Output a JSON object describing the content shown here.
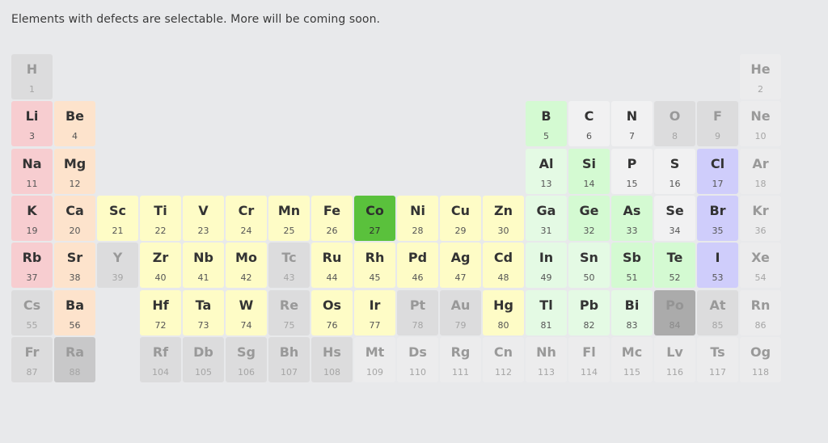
{
  "intro_text": "Elements with defects are selectable. More will be coming soon.",
  "palette": {
    "red": {
      "bg": "#f7cdd0",
      "fg": "#333333",
      "nfg": "#555555"
    },
    "peach": {
      "bg": "#fde3cc",
      "fg": "#333333",
      "nfg": "#555555"
    },
    "yellow": {
      "bg": "#fefcc6",
      "fg": "#333333",
      "nfg": "#555555"
    },
    "green": {
      "bg": "#d4fad2",
      "fg": "#333333",
      "nfg": "#555555"
    },
    "ltgreen": {
      "bg": "#e4fae4",
      "fg": "#333333",
      "nfg": "#555555"
    },
    "white": {
      "bg": "#f1f1f2",
      "fg": "#333333",
      "nfg": "#555555"
    },
    "blue": {
      "bg": "#cfcdfb",
      "fg": "#333333",
      "nfg": "#555555"
    },
    "selected": {
      "bg": "#5ac13c",
      "fg": "#2e2e2e",
      "nfg": "#2e2e2e"
    },
    "gray": {
      "bg": "#dcdcdd",
      "fg": "#999999",
      "nfg": "#a5a5a5"
    },
    "dkgray": {
      "bg": "#c8c8c9",
      "fg": "#9a9a9a",
      "nfg": "#a5a5a5"
    },
    "dkgray2": {
      "bg": "#ababab",
      "fg": "#949494",
      "nfg": "#8a8a8a"
    },
    "pale": {
      "bg": "#ececed",
      "fg": "#999999",
      "nfg": "#a5a5a5"
    }
  },
  "elements": [
    {
      "symbol": "H",
      "number": "1",
      "row": 1,
      "col": 1,
      "cat": "gray",
      "selectable": false
    },
    {
      "symbol": "He",
      "number": "2",
      "row": 1,
      "col": 18,
      "cat": "pale",
      "selectable": false
    },
    {
      "symbol": "Li",
      "number": "3",
      "row": 2,
      "col": 1,
      "cat": "red",
      "selectable": true
    },
    {
      "symbol": "Be",
      "number": "4",
      "row": 2,
      "col": 2,
      "cat": "peach",
      "selectable": true
    },
    {
      "symbol": "B",
      "number": "5",
      "row": 2,
      "col": 13,
      "cat": "green",
      "selectable": true
    },
    {
      "symbol": "C",
      "number": "6",
      "row": 2,
      "col": 14,
      "cat": "white",
      "selectable": true
    },
    {
      "symbol": "N",
      "number": "7",
      "row": 2,
      "col": 15,
      "cat": "white",
      "selectable": true
    },
    {
      "symbol": "O",
      "number": "8",
      "row": 2,
      "col": 16,
      "cat": "gray",
      "selectable": false
    },
    {
      "symbol": "F",
      "number": "9",
      "row": 2,
      "col": 17,
      "cat": "gray",
      "selectable": false
    },
    {
      "symbol": "Ne",
      "number": "10",
      "row": 2,
      "col": 18,
      "cat": "pale",
      "selectable": false
    },
    {
      "symbol": "Na",
      "number": "11",
      "row": 3,
      "col": 1,
      "cat": "red",
      "selectable": true
    },
    {
      "symbol": "Mg",
      "number": "12",
      "row": 3,
      "col": 2,
      "cat": "peach",
      "selectable": true
    },
    {
      "symbol": "Al",
      "number": "13",
      "row": 3,
      "col": 13,
      "cat": "ltgreen",
      "selectable": true
    },
    {
      "symbol": "Si",
      "number": "14",
      "row": 3,
      "col": 14,
      "cat": "green",
      "selectable": true
    },
    {
      "symbol": "P",
      "number": "15",
      "row": 3,
      "col": 15,
      "cat": "white",
      "selectable": true
    },
    {
      "symbol": "S",
      "number": "16",
      "row": 3,
      "col": 16,
      "cat": "white",
      "selectable": true
    },
    {
      "symbol": "Cl",
      "number": "17",
      "row": 3,
      "col": 17,
      "cat": "blue",
      "selectable": true
    },
    {
      "symbol": "Ar",
      "number": "18",
      "row": 3,
      "col": 18,
      "cat": "pale",
      "selectable": false
    },
    {
      "symbol": "K",
      "number": "19",
      "row": 4,
      "col": 1,
      "cat": "red",
      "selectable": true
    },
    {
      "symbol": "Ca",
      "number": "20",
      "row": 4,
      "col": 2,
      "cat": "peach",
      "selectable": true
    },
    {
      "symbol": "Sc",
      "number": "21",
      "row": 4,
      "col": 3,
      "cat": "yellow",
      "selectable": true
    },
    {
      "symbol": "Ti",
      "number": "22",
      "row": 4,
      "col": 4,
      "cat": "yellow",
      "selectable": true
    },
    {
      "symbol": "V",
      "number": "23",
      "row": 4,
      "col": 5,
      "cat": "yellow",
      "selectable": true
    },
    {
      "symbol": "Cr",
      "number": "24",
      "row": 4,
      "col": 6,
      "cat": "yellow",
      "selectable": true
    },
    {
      "symbol": "Mn",
      "number": "25",
      "row": 4,
      "col": 7,
      "cat": "yellow",
      "selectable": true
    },
    {
      "symbol": "Fe",
      "number": "26",
      "row": 4,
      "col": 8,
      "cat": "yellow",
      "selectable": true
    },
    {
      "symbol": "Co",
      "number": "27",
      "row": 4,
      "col": 9,
      "cat": "selected",
      "selectable": true
    },
    {
      "symbol": "Ni",
      "number": "28",
      "row": 4,
      "col": 10,
      "cat": "yellow",
      "selectable": true
    },
    {
      "symbol": "Cu",
      "number": "29",
      "row": 4,
      "col": 11,
      "cat": "yellow",
      "selectable": true
    },
    {
      "symbol": "Zn",
      "number": "30",
      "row": 4,
      "col": 12,
      "cat": "yellow",
      "selectable": true
    },
    {
      "symbol": "Ga",
      "number": "31",
      "row": 4,
      "col": 13,
      "cat": "ltgreen",
      "selectable": true
    },
    {
      "symbol": "Ge",
      "number": "32",
      "row": 4,
      "col": 14,
      "cat": "green",
      "selectable": true
    },
    {
      "symbol": "As",
      "number": "33",
      "row": 4,
      "col": 15,
      "cat": "green",
      "selectable": true
    },
    {
      "symbol": "Se",
      "number": "34",
      "row": 4,
      "col": 16,
      "cat": "white",
      "selectable": true
    },
    {
      "symbol": "Br",
      "number": "35",
      "row": 4,
      "col": 17,
      "cat": "blue",
      "selectable": true
    },
    {
      "symbol": "Kr",
      "number": "36",
      "row": 4,
      "col": 18,
      "cat": "pale",
      "selectable": false
    },
    {
      "symbol": "Rb",
      "number": "37",
      "row": 5,
      "col": 1,
      "cat": "red",
      "selectable": true
    },
    {
      "symbol": "Sr",
      "number": "38",
      "row": 5,
      "col": 2,
      "cat": "peach",
      "selectable": true
    },
    {
      "symbol": "Y",
      "number": "39",
      "row": 5,
      "col": 3,
      "cat": "gray",
      "selectable": false
    },
    {
      "symbol": "Zr",
      "number": "40",
      "row": 5,
      "col": 4,
      "cat": "yellow",
      "selectable": true
    },
    {
      "symbol": "Nb",
      "number": "41",
      "row": 5,
      "col": 5,
      "cat": "yellow",
      "selectable": true
    },
    {
      "symbol": "Mo",
      "number": "42",
      "row": 5,
      "col": 6,
      "cat": "yellow",
      "selectable": true
    },
    {
      "symbol": "Tc",
      "number": "43",
      "row": 5,
      "col": 7,
      "cat": "gray",
      "selectable": false
    },
    {
      "symbol": "Ru",
      "number": "44",
      "row": 5,
      "col": 8,
      "cat": "yellow",
      "selectable": true
    },
    {
      "symbol": "Rh",
      "number": "45",
      "row": 5,
      "col": 9,
      "cat": "yellow",
      "selectable": true
    },
    {
      "symbol": "Pd",
      "number": "46",
      "row": 5,
      "col": 10,
      "cat": "yellow",
      "selectable": true
    },
    {
      "symbol": "Ag",
      "number": "47",
      "row": 5,
      "col": 11,
      "cat": "yellow",
      "selectable": true
    },
    {
      "symbol": "Cd",
      "number": "48",
      "row": 5,
      "col": 12,
      "cat": "yellow",
      "selectable": true
    },
    {
      "symbol": "In",
      "number": "49",
      "row": 5,
      "col": 13,
      "cat": "ltgreen",
      "selectable": true
    },
    {
      "symbol": "Sn",
      "number": "50",
      "row": 5,
      "col": 14,
      "cat": "ltgreen",
      "selectable": true
    },
    {
      "symbol": "Sb",
      "number": "51",
      "row": 5,
      "col": 15,
      "cat": "green",
      "selectable": true
    },
    {
      "symbol": "Te",
      "number": "52",
      "row": 5,
      "col": 16,
      "cat": "green",
      "selectable": true
    },
    {
      "symbol": "I",
      "number": "53",
      "row": 5,
      "col": 17,
      "cat": "blue",
      "selectable": true
    },
    {
      "symbol": "Xe",
      "number": "54",
      "row": 5,
      "col": 18,
      "cat": "pale",
      "selectable": false
    },
    {
      "symbol": "Cs",
      "number": "55",
      "row": 6,
      "col": 1,
      "cat": "gray",
      "selectable": false
    },
    {
      "symbol": "Ba",
      "number": "56",
      "row": 6,
      "col": 2,
      "cat": "peach",
      "selectable": true
    },
    {
      "symbol": "Hf",
      "number": "72",
      "row": 6,
      "col": 4,
      "cat": "yellow",
      "selectable": true
    },
    {
      "symbol": "Ta",
      "number": "73",
      "row": 6,
      "col": 5,
      "cat": "yellow",
      "selectable": true
    },
    {
      "symbol": "W",
      "number": "74",
      "row": 6,
      "col": 6,
      "cat": "yellow",
      "selectable": true
    },
    {
      "symbol": "Re",
      "number": "75",
      "row": 6,
      "col": 7,
      "cat": "gray",
      "selectable": false
    },
    {
      "symbol": "Os",
      "number": "76",
      "row": 6,
      "col": 8,
      "cat": "yellow",
      "selectable": true
    },
    {
      "symbol": "Ir",
      "number": "77",
      "row": 6,
      "col": 9,
      "cat": "yellow",
      "selectable": true
    },
    {
      "symbol": "Pt",
      "number": "78",
      "row": 6,
      "col": 10,
      "cat": "gray",
      "selectable": false
    },
    {
      "symbol": "Au",
      "number": "79",
      "row": 6,
      "col": 11,
      "cat": "gray",
      "selectable": false
    },
    {
      "symbol": "Hg",
      "number": "80",
      "row": 6,
      "col": 12,
      "cat": "yellow",
      "selectable": true
    },
    {
      "symbol": "Tl",
      "number": "81",
      "row": 6,
      "col": 13,
      "cat": "ltgreen",
      "selectable": true
    },
    {
      "symbol": "Pb",
      "number": "82",
      "row": 6,
      "col": 14,
      "cat": "ltgreen",
      "selectable": true
    },
    {
      "symbol": "Bi",
      "number": "83",
      "row": 6,
      "col": 15,
      "cat": "ltgreen",
      "selectable": true
    },
    {
      "symbol": "Po",
      "number": "84",
      "row": 6,
      "col": 16,
      "cat": "dkgray2",
      "selectable": false
    },
    {
      "symbol": "At",
      "number": "85",
      "row": 6,
      "col": 17,
      "cat": "gray",
      "selectable": false
    },
    {
      "symbol": "Rn",
      "number": "86",
      "row": 6,
      "col": 18,
      "cat": "pale",
      "selectable": false
    },
    {
      "symbol": "Fr",
      "number": "87",
      "row": 7,
      "col": 1,
      "cat": "gray",
      "selectable": false
    },
    {
      "symbol": "Ra",
      "number": "88",
      "row": 7,
      "col": 2,
      "cat": "dkgray",
      "selectable": false
    },
    {
      "symbol": "Rf",
      "number": "104",
      "row": 7,
      "col": 4,
      "cat": "gray",
      "selectable": false
    },
    {
      "symbol": "Db",
      "number": "105",
      "row": 7,
      "col": 5,
      "cat": "gray",
      "selectable": false
    },
    {
      "symbol": "Sg",
      "number": "106",
      "row": 7,
      "col": 6,
      "cat": "gray",
      "selectable": false
    },
    {
      "symbol": "Bh",
      "number": "107",
      "row": 7,
      "col": 7,
      "cat": "gray",
      "selectable": false
    },
    {
      "symbol": "Hs",
      "number": "108",
      "row": 7,
      "col": 8,
      "cat": "gray",
      "selectable": false
    },
    {
      "symbol": "Mt",
      "number": "109",
      "row": 7,
      "col": 9,
      "cat": "pale",
      "selectable": false
    },
    {
      "symbol": "Ds",
      "number": "110",
      "row": 7,
      "col": 10,
      "cat": "pale",
      "selectable": false
    },
    {
      "symbol": "Rg",
      "number": "111",
      "row": 7,
      "col": 11,
      "cat": "pale",
      "selectable": false
    },
    {
      "symbol": "Cn",
      "number": "112",
      "row": 7,
      "col": 12,
      "cat": "pale",
      "selectable": false
    },
    {
      "symbol": "Nh",
      "number": "113",
      "row": 7,
      "col": 13,
      "cat": "pale",
      "selectable": false
    },
    {
      "symbol": "Fl",
      "number": "114",
      "row": 7,
      "col": 14,
      "cat": "pale",
      "selectable": false
    },
    {
      "symbol": "Mc",
      "number": "115",
      "row": 7,
      "col": 15,
      "cat": "pale",
      "selectable": false
    },
    {
      "symbol": "Lv",
      "number": "116",
      "row": 7,
      "col": 16,
      "cat": "pale",
      "selectable": false
    },
    {
      "symbol": "Ts",
      "number": "117",
      "row": 7,
      "col": 17,
      "cat": "pale",
      "selectable": false
    },
    {
      "symbol": "Og",
      "number": "118",
      "row": 7,
      "col": 18,
      "cat": "pale",
      "selectable": false
    }
  ]
}
